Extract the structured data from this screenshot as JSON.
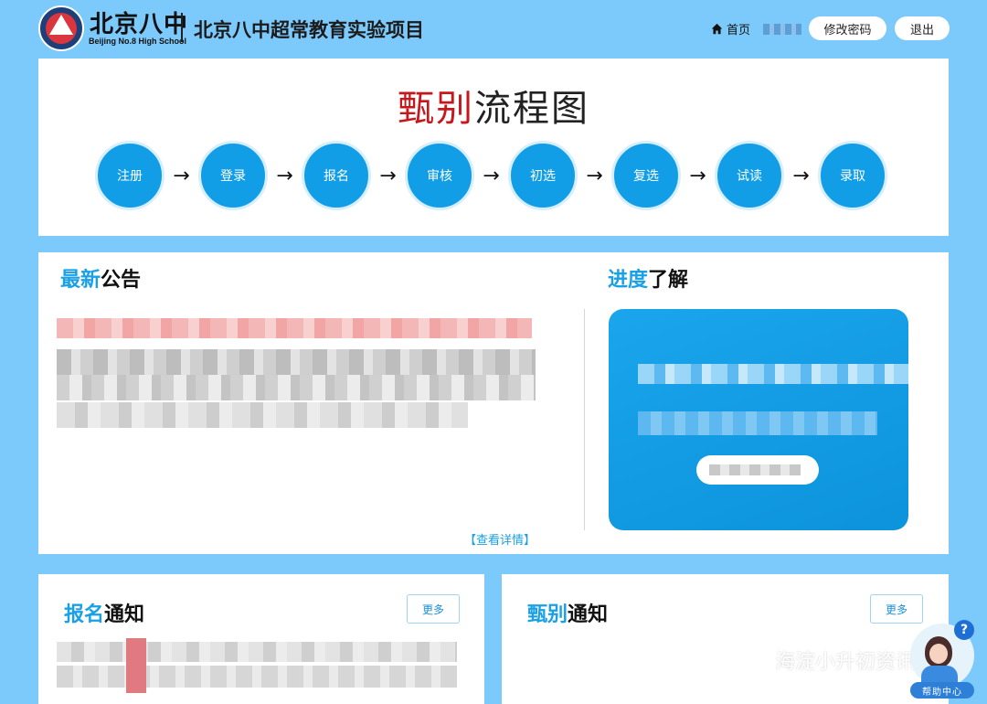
{
  "header": {
    "logo_cn": "北京八中",
    "logo_en": "Beijing No.8 High School",
    "site_title": "北京八中超常教育实验项目",
    "nav_home": "首页",
    "change_password": "修改密码",
    "logout": "退出"
  },
  "flow": {
    "title_red": "甄别",
    "title_rest": "流程图",
    "steps": [
      "注册",
      "登录",
      "报名",
      "审核",
      "初选",
      "复选",
      "试读",
      "录取"
    ],
    "arrow": "→"
  },
  "notice": {
    "title_blue": "最新",
    "title_rest": "公告",
    "detail_link": "【查看详情】"
  },
  "progress": {
    "title_blue": "进度",
    "title_rest": "了解"
  },
  "registration": {
    "title_blue": "报名",
    "title_rest": "通知",
    "more": "更多"
  },
  "selection": {
    "title_blue": "甄别",
    "title_rest": "通知",
    "more": "更多"
  },
  "watermark": "海淀小升初资讯",
  "help": {
    "label": "帮助中心",
    "q": "?"
  },
  "colors": {
    "background": "#7cc9fb",
    "accent_blue": "#1aa0e6",
    "step_blue": "#119ee6",
    "title_red": "#c8161d"
  }
}
